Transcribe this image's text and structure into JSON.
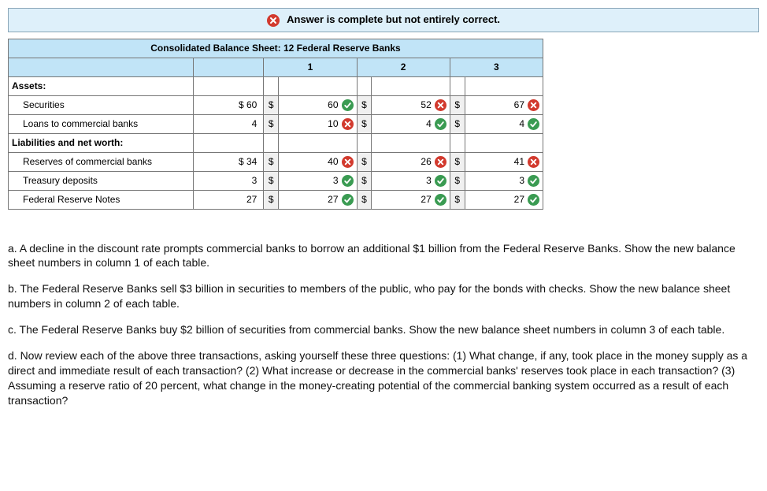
{
  "banner": {
    "text": "Answer is complete but not entirely correct."
  },
  "table": {
    "title": "Consolidated Balance Sheet: 12 Federal Reserve Banks",
    "col_headers": [
      "1",
      "2",
      "3"
    ],
    "sections": [
      {
        "label": "Assets:",
        "rows": [
          {
            "label": "Securities",
            "base": "$ 60",
            "cells": [
              {
                "dollar": "$",
                "value": "60",
                "mark": "correct"
              },
              {
                "dollar": "$",
                "value": "52",
                "mark": "wrong"
              },
              {
                "dollar": "$",
                "value": "67",
                "mark": "wrong"
              }
            ]
          },
          {
            "label": "Loans to commercial banks",
            "base": "4",
            "cells": [
              {
                "dollar": "$",
                "value": "10",
                "mark": "wrong"
              },
              {
                "dollar": "$",
                "value": "4",
                "mark": "correct"
              },
              {
                "dollar": "$",
                "value": "4",
                "mark": "correct"
              }
            ]
          }
        ]
      },
      {
        "label": "Liabilities and net worth:",
        "rows": [
          {
            "label": "Reserves of commercial banks",
            "base": "$ 34",
            "cells": [
              {
                "dollar": "$",
                "value": "40",
                "mark": "wrong"
              },
              {
                "dollar": "$",
                "value": "26",
                "mark": "wrong"
              },
              {
                "dollar": "$",
                "value": "41",
                "mark": "wrong"
              }
            ]
          },
          {
            "label": "Treasury deposits",
            "base": "3",
            "cells": [
              {
                "dollar": "$",
                "value": "3",
                "mark": "correct"
              },
              {
                "dollar": "$",
                "value": "3",
                "mark": "correct"
              },
              {
                "dollar": "$",
                "value": "3",
                "mark": "correct"
              }
            ]
          },
          {
            "label": "Federal Reserve Notes",
            "base": "27",
            "cells": [
              {
                "dollar": "$",
                "value": "27",
                "mark": "correct"
              },
              {
                "dollar": "$",
                "value": "27",
                "mark": "correct"
              },
              {
                "dollar": "$",
                "value": "27",
                "mark": "correct"
              }
            ]
          }
        ]
      }
    ]
  },
  "paragraphs": [
    "a. A decline in the discount rate prompts commercial banks to borrow an additional $1 billion from the Federal Reserve Banks. Show the new balance sheet numbers in column 1 of each table.",
    "b. The Federal Reserve Banks sell $3 billion in securities to members of the public, who pay for the bonds with checks. Show the new balance sheet numbers in column 2 of each table.",
    "c. The Federal Reserve Banks buy $2 billion of securities from commercial banks. Show the new balance sheet numbers in column 3 of each table.",
    "d. Now review each of the above three transactions, asking yourself these three questions: (1) What change, if any, took place in the money supply as a direct and immediate result of each transaction? (2) What increase or decrease in the commercial banks' reserves took place in each transaction? (3) Assuming a reserve ratio of 20 percent, what change in the money-creating potential of the commercial banking system occurred as a result of each transaction?"
  ]
}
